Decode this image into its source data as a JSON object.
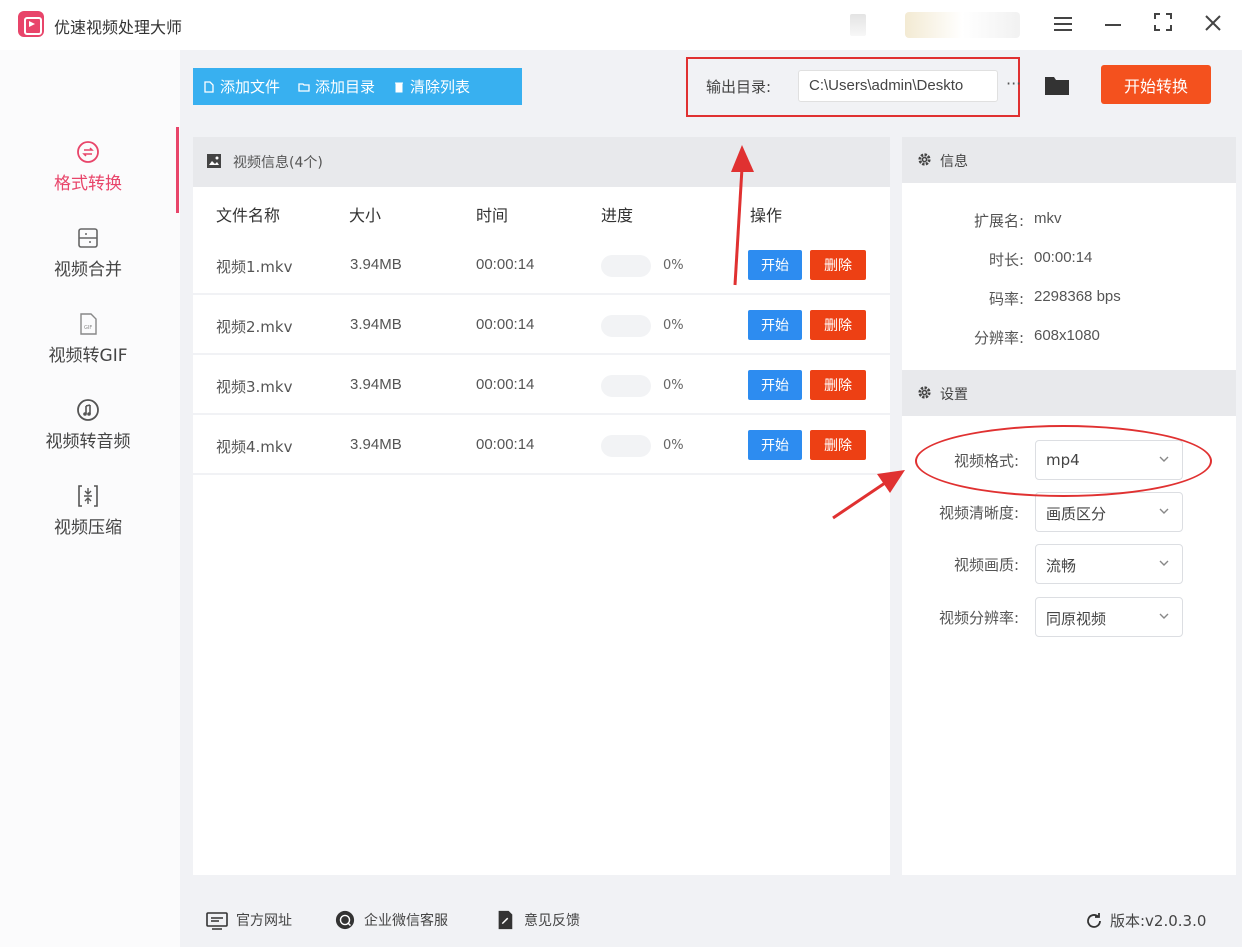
{
  "app": {
    "title": "优速视频处理大师"
  },
  "window": {
    "menu_icon": "menu-icon",
    "min_icon": "minimize-icon",
    "max_icon": "maximize-icon",
    "close_icon": "close-icon"
  },
  "sidebar": {
    "items": [
      {
        "label": "格式转换",
        "icon": "format-convert-icon",
        "active": true
      },
      {
        "label": "视频合并",
        "icon": "video-merge-icon",
        "active": false
      },
      {
        "label": "视频转GIF",
        "icon": "gif-icon",
        "active": false
      },
      {
        "label": "视频转音频",
        "icon": "audio-icon",
        "active": false
      },
      {
        "label": "视频压缩",
        "icon": "compress-icon",
        "active": false
      }
    ]
  },
  "toolbar": {
    "add_file": "添加文件",
    "add_dir": "添加目录",
    "clear_list": "清除列表"
  },
  "output": {
    "label": "输出目录:",
    "path": "C:\\Users\\admin\\Deskto",
    "more": "···",
    "start_all": "开始转换"
  },
  "video_list": {
    "title": "视频信息(4个)",
    "columns": [
      "文件名称",
      "大小",
      "时间",
      "进度",
      "操作"
    ],
    "rows": [
      {
        "name": "视频1.mkv",
        "size": "3.94MB",
        "duration": "00:00:14",
        "progress": "0%",
        "start": "开始",
        "delete": "删除"
      },
      {
        "name": "视频2.mkv",
        "size": "3.94MB",
        "duration": "00:00:14",
        "progress": "0%",
        "start": "开始",
        "delete": "删除"
      },
      {
        "name": "视频3.mkv",
        "size": "3.94MB",
        "duration": "00:00:14",
        "progress": "0%",
        "start": "开始",
        "delete": "删除"
      },
      {
        "name": "视频4.mkv",
        "size": "3.94MB",
        "duration": "00:00:14",
        "progress": "0%",
        "start": "开始",
        "delete": "删除"
      }
    ]
  },
  "info": {
    "title": "信息",
    "fields": [
      {
        "label": "扩展名:",
        "value": "mkv"
      },
      {
        "label": "时长:",
        "value": "00:00:14"
      },
      {
        "label": "码率:",
        "value": "2298368 bps"
      },
      {
        "label": "分辨率:",
        "value": "608x1080"
      }
    ]
  },
  "settings": {
    "title": "设置",
    "fields": [
      {
        "label": "视频格式:",
        "value": "mp4"
      },
      {
        "label": "视频清晰度:",
        "value": "画质区分"
      },
      {
        "label": "视频画质:",
        "value": "流畅"
      },
      {
        "label": "视频分辨率:",
        "value": "同原视频"
      }
    ]
  },
  "footer": {
    "website": "官方网址",
    "wechat": "企业微信客服",
    "feedback": "意见反馈",
    "version": "版本:v2.0.3.0"
  },
  "colors": {
    "accent": "#e8456a",
    "toolbar": "#38b0f0",
    "start_button": "#2d8cf0",
    "delete_button": "#ed4014",
    "convert_button": "#f4511e",
    "annotation": "#e03131"
  }
}
